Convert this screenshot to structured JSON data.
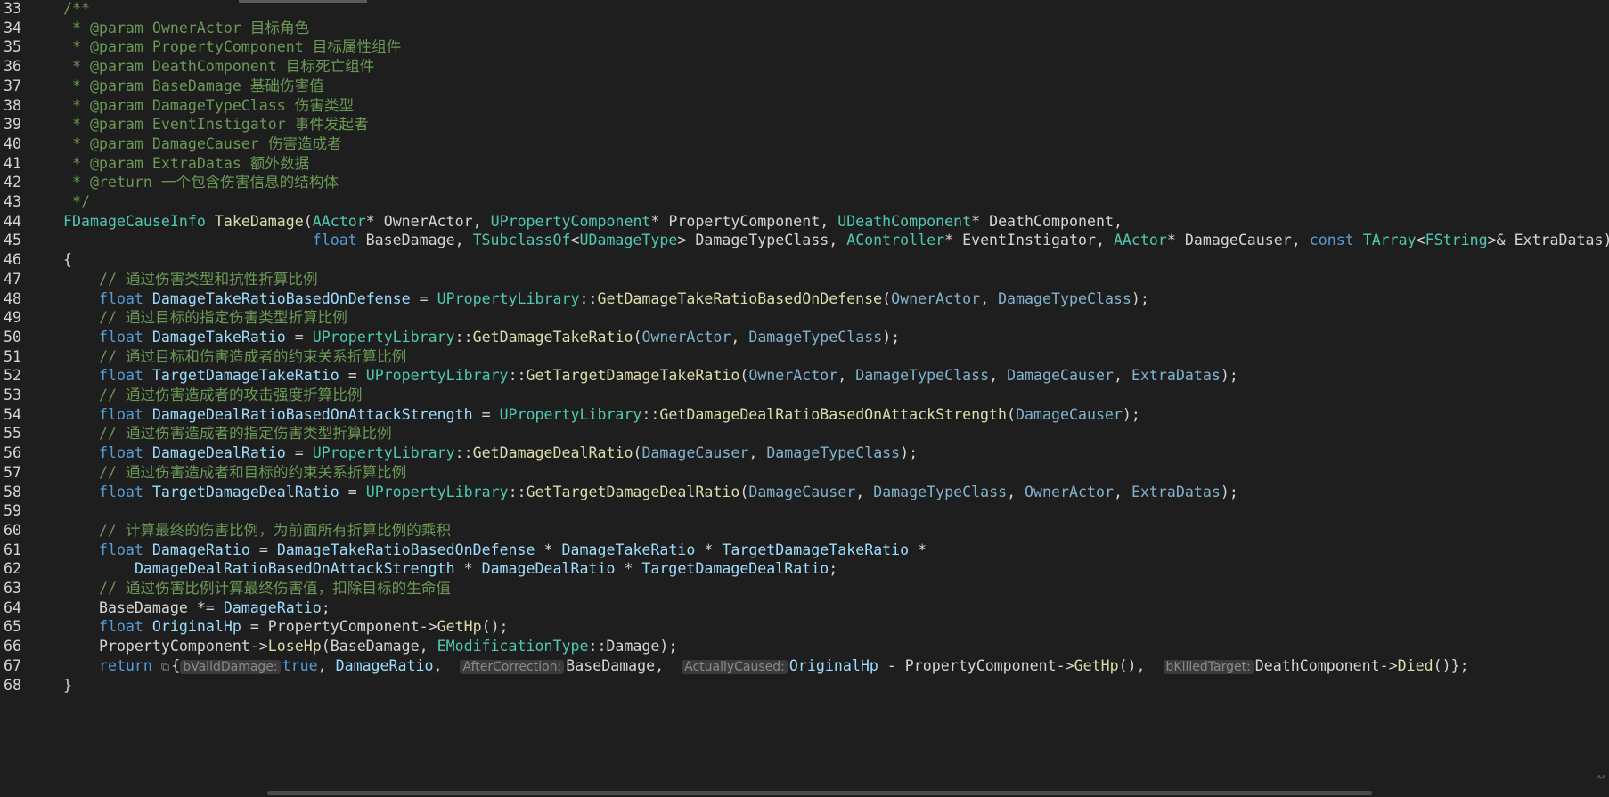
{
  "editor": {
    "lines": [
      {
        "n": "33",
        "tokens": [
          {
            "t": "/**",
            "c": "comment"
          }
        ]
      },
      {
        "n": "34",
        "tokens": [
          {
            "t": " * @param OwnerActor 目标角色",
            "c": "comment"
          }
        ]
      },
      {
        "n": "35",
        "tokens": [
          {
            "t": " * @param PropertyComponent 目标属性组件",
            "c": "comment"
          }
        ]
      },
      {
        "n": "36",
        "tokens": [
          {
            "t": " * @param DeathComponent 目标死亡组件",
            "c": "comment"
          }
        ]
      },
      {
        "n": "37",
        "tokens": [
          {
            "t": " * @param BaseDamage 基础伤害值",
            "c": "comment"
          }
        ]
      },
      {
        "n": "38",
        "tokens": [
          {
            "t": " * @param DamageTypeClass 伤害类型",
            "c": "comment"
          }
        ]
      },
      {
        "n": "39",
        "tokens": [
          {
            "t": " * @param EventInstigator 事件发起者",
            "c": "comment"
          }
        ]
      },
      {
        "n": "40",
        "tokens": [
          {
            "t": " * @param DamageCauser 伤害造成者",
            "c": "comment"
          }
        ]
      },
      {
        "n": "41",
        "tokens": [
          {
            "t": " * @param ExtraDatas 额外数据",
            "c": "comment"
          }
        ]
      },
      {
        "n": "42",
        "tokens": [
          {
            "t": " * @return 一个包含伤害信息的结构体",
            "c": "comment"
          }
        ]
      },
      {
        "n": "43",
        "tokens": [
          {
            "t": " */",
            "c": "comment"
          }
        ]
      },
      {
        "n": "44",
        "tokens": [
          {
            "t": "FDamageCauseInfo",
            "c": "type"
          },
          {
            "t": " ",
            "c": "plain"
          },
          {
            "t": "TakeDamage",
            "c": "fn"
          },
          {
            "t": "(",
            "c": "plain"
          },
          {
            "t": "AActor",
            "c": "type"
          },
          {
            "t": "* ",
            "c": "plain"
          },
          {
            "t": "OwnerActor",
            "c": "plain"
          },
          {
            "t": ", ",
            "c": "plain"
          },
          {
            "t": "UPropertyComponent",
            "c": "type"
          },
          {
            "t": "* ",
            "c": "plain"
          },
          {
            "t": "PropertyComponent",
            "c": "plain"
          },
          {
            "t": ", ",
            "c": "plain"
          },
          {
            "t": "UDeathComponent",
            "c": "type"
          },
          {
            "t": "* ",
            "c": "plain"
          },
          {
            "t": "DeathComponent",
            "c": "plain"
          },
          {
            "t": ",",
            "c": "plain"
          }
        ]
      },
      {
        "n": "45",
        "tokens": [
          {
            "t": "                            ",
            "c": "plain"
          },
          {
            "t": "float",
            "c": "kw"
          },
          {
            "t": " BaseDamage, ",
            "c": "plain"
          },
          {
            "t": "TSubclassOf",
            "c": "type"
          },
          {
            "t": "<",
            "c": "plain"
          },
          {
            "t": "UDamageType",
            "c": "type"
          },
          {
            "t": "> DamageTypeClass, ",
            "c": "plain"
          },
          {
            "t": "AController",
            "c": "type"
          },
          {
            "t": "* EventInstigator, ",
            "c": "plain"
          },
          {
            "t": "AActor",
            "c": "type"
          },
          {
            "t": "* DamageCauser, ",
            "c": "plain"
          },
          {
            "t": "const",
            "c": "kw"
          },
          {
            "t": " ",
            "c": "plain"
          },
          {
            "t": "TArray",
            "c": "type"
          },
          {
            "t": "<",
            "c": "plain"
          },
          {
            "t": "FString",
            "c": "type"
          },
          {
            "t": ">& ExtraDatas)",
            "c": "plain"
          }
        ]
      },
      {
        "n": "46",
        "tokens": [
          {
            "t": "{",
            "c": "plain"
          }
        ]
      },
      {
        "n": "47",
        "tokens": [
          {
            "t": "    // 通过伤害类型和抗性折算比例",
            "c": "comment"
          }
        ]
      },
      {
        "n": "48",
        "tokens": [
          {
            "t": "    ",
            "c": "plain"
          },
          {
            "t": "float",
            "c": "kw"
          },
          {
            "t": " ",
            "c": "plain"
          },
          {
            "t": "DamageTakeRatioBasedOnDefense",
            "c": "var"
          },
          {
            "t": " = ",
            "c": "plain"
          },
          {
            "t": "UPropertyLibrary",
            "c": "type"
          },
          {
            "t": "::",
            "c": "plain"
          },
          {
            "t": "GetDamageTakeRatioBasedOnDefense",
            "c": "fn"
          },
          {
            "t": "(",
            "c": "plain"
          },
          {
            "t": "OwnerActor",
            "c": "param"
          },
          {
            "t": ", ",
            "c": "plain"
          },
          {
            "t": "DamageTypeClass",
            "c": "param"
          },
          {
            "t": ");",
            "c": "plain"
          }
        ]
      },
      {
        "n": "49",
        "tokens": [
          {
            "t": "    // 通过目标的指定伤害类型折算比例",
            "c": "comment"
          }
        ]
      },
      {
        "n": "50",
        "tokens": [
          {
            "t": "    ",
            "c": "plain"
          },
          {
            "t": "float",
            "c": "kw"
          },
          {
            "t": " ",
            "c": "plain"
          },
          {
            "t": "DamageTakeRatio",
            "c": "var"
          },
          {
            "t": " = ",
            "c": "plain"
          },
          {
            "t": "UPropertyLibrary",
            "c": "type"
          },
          {
            "t": "::",
            "c": "plain"
          },
          {
            "t": "GetDamageTakeRatio",
            "c": "fn"
          },
          {
            "t": "(",
            "c": "plain"
          },
          {
            "t": "OwnerActor",
            "c": "param"
          },
          {
            "t": ", ",
            "c": "plain"
          },
          {
            "t": "DamageTypeClass",
            "c": "param"
          },
          {
            "t": ");",
            "c": "plain"
          }
        ]
      },
      {
        "n": "51",
        "tokens": [
          {
            "t": "    // 通过目标和伤害造成者的约束关系折算比例",
            "c": "comment"
          }
        ]
      },
      {
        "n": "52",
        "tokens": [
          {
            "t": "    ",
            "c": "plain"
          },
          {
            "t": "float",
            "c": "kw"
          },
          {
            "t": " ",
            "c": "plain"
          },
          {
            "t": "TargetDamageTakeRatio",
            "c": "var"
          },
          {
            "t": " = ",
            "c": "plain"
          },
          {
            "t": "UPropertyLibrary",
            "c": "type"
          },
          {
            "t": "::",
            "c": "plain"
          },
          {
            "t": "GetTargetDamageTakeRatio",
            "c": "fn"
          },
          {
            "t": "(",
            "c": "plain"
          },
          {
            "t": "OwnerActor",
            "c": "param"
          },
          {
            "t": ", ",
            "c": "plain"
          },
          {
            "t": "DamageTypeClass",
            "c": "param"
          },
          {
            "t": ", ",
            "c": "plain"
          },
          {
            "t": "DamageCauser",
            "c": "param"
          },
          {
            "t": ", ",
            "c": "plain"
          },
          {
            "t": "ExtraDatas",
            "c": "param"
          },
          {
            "t": ");",
            "c": "plain"
          }
        ]
      },
      {
        "n": "53",
        "tokens": [
          {
            "t": "    // 通过伤害造成者的攻击强度折算比例",
            "c": "comment"
          }
        ]
      },
      {
        "n": "54",
        "tokens": [
          {
            "t": "    ",
            "c": "plain"
          },
          {
            "t": "float",
            "c": "kw"
          },
          {
            "t": " ",
            "c": "plain"
          },
          {
            "t": "DamageDealRatioBasedOnAttackStrength",
            "c": "var"
          },
          {
            "t": " = ",
            "c": "plain"
          },
          {
            "t": "UPropertyLibrary",
            "c": "type"
          },
          {
            "t": "::",
            "c": "plain"
          },
          {
            "t": "GetDamageDealRatioBasedOnAttackStrength",
            "c": "fn"
          },
          {
            "t": "(",
            "c": "plain"
          },
          {
            "t": "DamageCauser",
            "c": "param"
          },
          {
            "t": ");",
            "c": "plain"
          }
        ]
      },
      {
        "n": "55",
        "tokens": [
          {
            "t": "    // 通过伤害造成者的指定伤害类型折算比例",
            "c": "comment"
          }
        ]
      },
      {
        "n": "56",
        "tokens": [
          {
            "t": "    ",
            "c": "plain"
          },
          {
            "t": "float",
            "c": "kw"
          },
          {
            "t": " ",
            "c": "plain"
          },
          {
            "t": "DamageDealRatio",
            "c": "var"
          },
          {
            "t": " = ",
            "c": "plain"
          },
          {
            "t": "UPropertyLibrary",
            "c": "type"
          },
          {
            "t": "::",
            "c": "plain"
          },
          {
            "t": "GetDamageDealRatio",
            "c": "fn"
          },
          {
            "t": "(",
            "c": "plain"
          },
          {
            "t": "DamageCauser",
            "c": "param"
          },
          {
            "t": ", ",
            "c": "plain"
          },
          {
            "t": "DamageTypeClass",
            "c": "param"
          },
          {
            "t": ");",
            "c": "plain"
          }
        ]
      },
      {
        "n": "57",
        "tokens": [
          {
            "t": "    // 通过伤害造成者和目标的约束关系折算比例",
            "c": "comment"
          }
        ]
      },
      {
        "n": "58",
        "tokens": [
          {
            "t": "    ",
            "c": "plain"
          },
          {
            "t": "float",
            "c": "kw"
          },
          {
            "t": " ",
            "c": "plain"
          },
          {
            "t": "TargetDamageDealRatio",
            "c": "var"
          },
          {
            "t": " = ",
            "c": "plain"
          },
          {
            "t": "UPropertyLibrary",
            "c": "type"
          },
          {
            "t": "::",
            "c": "plain"
          },
          {
            "t": "GetTargetDamageDealRatio",
            "c": "fn"
          },
          {
            "t": "(",
            "c": "plain"
          },
          {
            "t": "DamageCauser",
            "c": "param"
          },
          {
            "t": ", ",
            "c": "plain"
          },
          {
            "t": "DamageTypeClass",
            "c": "param"
          },
          {
            "t": ", ",
            "c": "plain"
          },
          {
            "t": "OwnerActor",
            "c": "param"
          },
          {
            "t": ", ",
            "c": "plain"
          },
          {
            "t": "ExtraDatas",
            "c": "param"
          },
          {
            "t": ");",
            "c": "plain"
          }
        ]
      },
      {
        "n": "59",
        "tokens": []
      },
      {
        "n": "60",
        "tokens": [
          {
            "t": "    // 计算最终的伤害比例，为前面所有折算比例的乘积",
            "c": "comment"
          }
        ]
      },
      {
        "n": "61",
        "tokens": [
          {
            "t": "    ",
            "c": "plain"
          },
          {
            "t": "float",
            "c": "kw"
          },
          {
            "t": " ",
            "c": "plain"
          },
          {
            "t": "DamageRatio",
            "c": "var"
          },
          {
            "t": " = ",
            "c": "plain"
          },
          {
            "t": "DamageTakeRatioBasedOnDefense",
            "c": "var"
          },
          {
            "t": " * ",
            "c": "plain"
          },
          {
            "t": "DamageTakeRatio",
            "c": "var"
          },
          {
            "t": " * ",
            "c": "plain"
          },
          {
            "t": "TargetDamageTakeRatio",
            "c": "var"
          },
          {
            "t": " *",
            "c": "plain"
          }
        ]
      },
      {
        "n": "62",
        "tokens": [
          {
            "t": "        ",
            "c": "plain"
          },
          {
            "t": "DamageDealRatioBasedOnAttackStrength",
            "c": "var"
          },
          {
            "t": " * ",
            "c": "plain"
          },
          {
            "t": "DamageDealRatio",
            "c": "var"
          },
          {
            "t": " * ",
            "c": "plain"
          },
          {
            "t": "TargetDamageDealRatio",
            "c": "var"
          },
          {
            "t": ";",
            "c": "plain"
          }
        ]
      },
      {
        "n": "63",
        "tokens": [
          {
            "t": "    // 通过伤害比例计算最终伤害值，扣除目标的生命值",
            "c": "comment"
          }
        ]
      },
      {
        "n": "64",
        "tokens": [
          {
            "t": "    BaseDamage *= ",
            "c": "plain"
          },
          {
            "t": "DamageRatio",
            "c": "var"
          },
          {
            "t": ";",
            "c": "plain"
          }
        ]
      },
      {
        "n": "65",
        "tokens": [
          {
            "t": "    ",
            "c": "plain"
          },
          {
            "t": "float",
            "c": "kw"
          },
          {
            "t": " ",
            "c": "plain"
          },
          {
            "t": "OriginalHp",
            "c": "var"
          },
          {
            "t": " = PropertyComponent->",
            "c": "plain"
          },
          {
            "t": "GetHp",
            "c": "fn"
          },
          {
            "t": "();",
            "c": "plain"
          }
        ]
      },
      {
        "n": "66",
        "tokens": [
          {
            "t": "    PropertyComponent->",
            "c": "plain"
          },
          {
            "t": "LoseHp",
            "c": "fn"
          },
          {
            "t": "(BaseDamage, ",
            "c": "plain"
          },
          {
            "t": "EModificationType",
            "c": "type"
          },
          {
            "t": "::Damage);",
            "c": "plain"
          }
        ]
      },
      {
        "n": "67",
        "tokens": [
          {
            "t": "    ",
            "c": "plain"
          },
          {
            "t": "return",
            "c": "kw"
          },
          {
            "t": " ",
            "c": "plain"
          },
          {
            "t": "⧉",
            "c": "hinticon"
          },
          {
            "t": "{",
            "c": "plain"
          },
          {
            "t": "bValidDamage:",
            "c": "hint"
          },
          {
            "t": "true",
            "c": "kw"
          },
          {
            "t": ", ",
            "c": "plain"
          },
          {
            "t": "DamageRatio",
            "c": "var"
          },
          {
            "t": ",  ",
            "c": "plain"
          },
          {
            "t": "AfterCorrection:",
            "c": "hint"
          },
          {
            "t": "BaseDamage,  ",
            "c": "plain"
          },
          {
            "t": "ActuallyCaused:",
            "c": "hint"
          },
          {
            "t": "OriginalHp",
            "c": "var"
          },
          {
            "t": " - PropertyComponent->",
            "c": "plain"
          },
          {
            "t": "GetHp",
            "c": "fn"
          },
          {
            "t": "(),  ",
            "c": "plain"
          },
          {
            "t": "bKilledTarget:",
            "c": "hint"
          },
          {
            "t": "DeathComponent->",
            "c": "plain"
          },
          {
            "t": "Died",
            "c": "fn"
          },
          {
            "t": "()};",
            "c": "plain"
          }
        ]
      },
      {
        "n": "68",
        "tokens": [
          {
            "t": "}",
            "c": "plain"
          }
        ]
      }
    ]
  },
  "colors": {
    "background": "#1e1e1e",
    "comment": "#6a9955",
    "type": "#4ec9b0",
    "function": "#dcdcaa",
    "keyword": "#569cd6",
    "variable": "#9cdcfe",
    "text": "#d4d4d4"
  },
  "corner_glyph": "ᴬᴬ"
}
